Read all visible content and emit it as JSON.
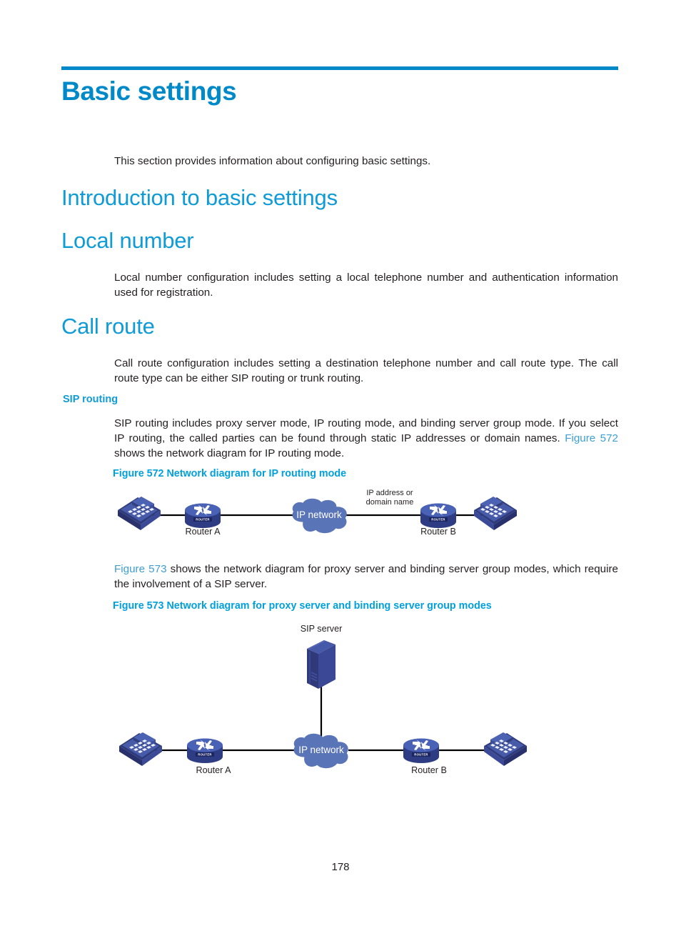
{
  "document": {
    "page_number": "178",
    "accent_rule_color": "#0089c8",
    "heading_color": "#0f9bd7",
    "link_color": "#3d9fd2",
    "caption_color": "#00a0dd",
    "body_color": "#231f20"
  },
  "headings": {
    "h1_basic_settings": "Basic settings",
    "h2_introduction": "Introduction to basic settings",
    "h2_local_number": "Local number",
    "h2_call_route": "Call route",
    "h3_sip_routing": "SIP routing"
  },
  "paragraphs": {
    "intro": "This section provides information about configuring basic settings.",
    "local_number": "Local number configuration includes setting a local telephone number and authentication information used for registration.",
    "call_route": "Call route configuration includes setting a destination telephone number and call route type. The call route type can be either SIP routing or trunk routing.",
    "sip_routing_part1": "SIP routing includes proxy server mode, IP routing mode, and binding server group mode. If you select IP routing, the called parties can be found through static IP addresses or domain names. ",
    "sip_routing_link": "Figure 572",
    "sip_routing_part2": " shows the network diagram for IP routing mode.",
    "fig573_lead_link": "Figure 573",
    "fig573_lead_rest": " shows the network diagram for proxy server and binding server group modes, which require the involvement of a SIP server."
  },
  "figures": {
    "fig572": {
      "caption": "Figure 572 Network diagram for IP routing mode",
      "nodes": {
        "phone_left": "phone-icon",
        "router_a_label": "Router A",
        "router_badge": "ROUTER",
        "cloud_label": "IP network",
        "annotation_line1": "IP address or",
        "annotation_line2": "domain name",
        "router_b_label": "Router B",
        "phone_right": "phone-icon"
      }
    },
    "fig573": {
      "caption": "Figure 573 Network diagram for proxy server and binding server group modes",
      "nodes": {
        "server_label": "SIP server",
        "phone_left": "phone-icon",
        "router_a_label": "Router A",
        "router_badge": "ROUTER",
        "cloud_label": "IP network",
        "router_b_label": "Router B",
        "phone_right": "phone-icon"
      }
    }
  },
  "colors": {
    "cloud_fill": "#5a74b8",
    "router_body": "#3a4f9e",
    "router_top": "#4a62b5",
    "phone_body": "#3c4a8e",
    "server_front": "#303a7a",
    "server_side": "#4658a8",
    "link_line": "#000000"
  }
}
